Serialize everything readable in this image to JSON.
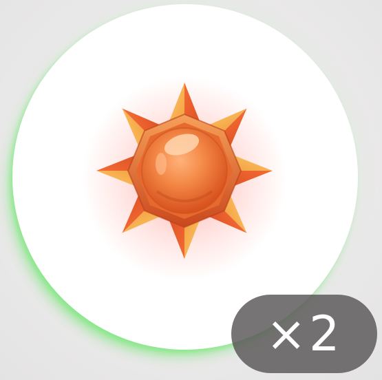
{
  "item": {
    "icon": "sun-stone-icon",
    "quantity_label": "×2"
  },
  "colors": {
    "slot_background": "#ffffff",
    "slot_rim_glow": "#7ee87e",
    "badge_background": "#585656",
    "badge_text": "#ffffff",
    "gem_core": "#f07a3a",
    "gem_spike_light": "#f9b24a",
    "gem_spike_dark": "#e2582a"
  }
}
